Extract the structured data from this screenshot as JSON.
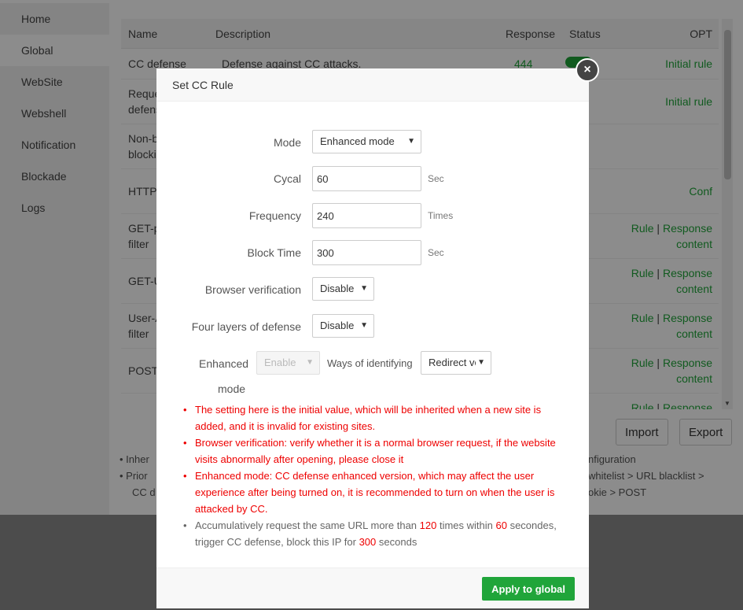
{
  "sidebar": {
    "items": [
      {
        "label": "Home"
      },
      {
        "label": "Global"
      },
      {
        "label": "WebSite"
      },
      {
        "label": "Webshell"
      },
      {
        "label": "Notification"
      },
      {
        "label": "Blockade"
      },
      {
        "label": "Logs"
      }
    ]
  },
  "table": {
    "headers": {
      "name": "Name",
      "description": "Description",
      "response": "Response",
      "status": "Status",
      "opt": "OPT"
    },
    "rows": [
      {
        "name": "CC defense",
        "description": "Defense against CC attacks.",
        "response": "444",
        "opt": "Initial rule"
      },
      {
        "name": "Reque defens",
        "opt": "Initial rule"
      },
      {
        "name": "Non-b blocki"
      },
      {
        "name": "HTTP",
        "opt": "Conf"
      },
      {
        "name": "GET-p filter",
        "opt_rule": "Rule",
        "opt_sep": "|",
        "opt_resp": "Response content"
      },
      {
        "name": "GET-U",
        "opt_rule": "Rule",
        "opt_sep": "|",
        "opt_resp": "Response content"
      },
      {
        "name": "User-A filter",
        "opt_rule": "Rule",
        "opt_sep": "|",
        "opt_resp": "Response content"
      },
      {
        "name": "POST",
        "opt_rule": "Rule",
        "opt_sep": "|",
        "opt_resp": "Response content"
      },
      {
        "name": "",
        "opt_rule": "Rule",
        "opt_sep": "|",
        "opt_resp": "Response"
      }
    ]
  },
  "buttons": {
    "import": "Import",
    "export": "Export"
  },
  "notes": {
    "left_1": "Inher",
    "left_2": "Prior",
    "left_3": "CC d",
    "right_1": "nfiguration",
    "right_2": "whitelist > URL blacklist >",
    "right_3": "okie > POST"
  },
  "modal": {
    "title": "Set CC Rule",
    "close": "×",
    "mode": {
      "label": "Mode",
      "value": "Enhanced mode"
    },
    "cycal": {
      "label": "Cycal",
      "value": "60",
      "unit": "Sec"
    },
    "frequency": {
      "label": "Frequency",
      "value": "240",
      "unit": "Times"
    },
    "block_time": {
      "label": "Block Time",
      "value": "300",
      "unit": "Sec"
    },
    "browser_verification": {
      "label": "Browser verification",
      "value": "Disable"
    },
    "four_layers": {
      "label": "Four layers of defense",
      "value": "Disable"
    },
    "enhanced": {
      "label_1": "Enhanced",
      "label_2": "mode",
      "value": "Enable",
      "ways_label": "Ways of identifying",
      "ways_value": "Redirect ve"
    },
    "tips": {
      "t1": "The setting here is the initial value, which will be inherited when a new site is added, and it is invalid for existing sites.",
      "t2": "Browser verification: verify whether it is a normal browser request, if the website visits abnormally after opening, please close it",
      "t3": "Enhanced mode: CC defense enhanced version, which may affect the user experience after being turned on, it is recommended to turn on when the user is attacked by CC.",
      "t4_a": "Accumulatively request the same URL more than ",
      "t4_n1": "120",
      "t4_b": " times within ",
      "t4_n2": "60",
      "t4_c": " secondes, trigger CC defense, block this IP for ",
      "t4_n3": "300",
      "t4_d": " seconds"
    },
    "apply": "Apply to global"
  },
  "colors": {
    "accent": "#20a53a",
    "warning": "#e00000"
  }
}
